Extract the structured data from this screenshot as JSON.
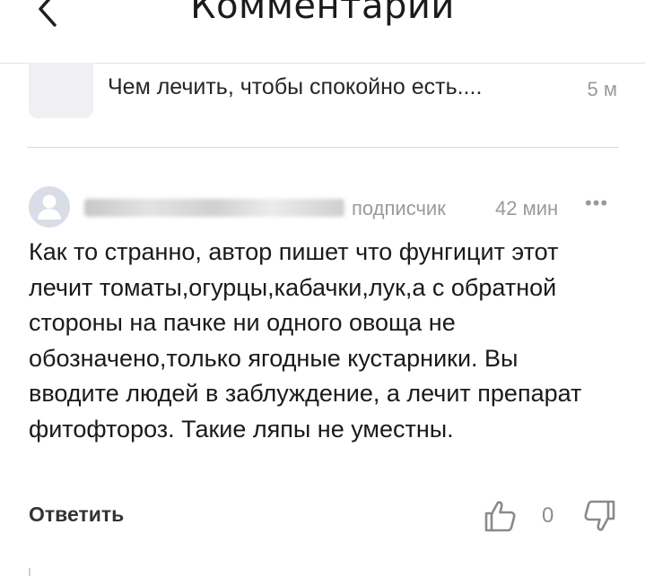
{
  "header": {
    "title": "Комментарии",
    "back_icon": "chevron-left-icon"
  },
  "article": {
    "title": "Чем лечить, чтобы спокойно есть....",
    "time": "5 м"
  },
  "comment": {
    "author_name": "",
    "author_badge": "подписчик",
    "time": "42 мин",
    "more_label": "•••",
    "text": "Как то странно, автор пишет что фунгицит этот лечит томаты,огурцы,кабачки,лук,а с обратной стороны на пачке ни одного овоща не обозначено,только ягодные кустарники. Вы вводите людей в заблуждение, а лечит препарат фитофтороз. Такие ляпы не уместны.",
    "reply_label": "Ответить",
    "like_count": "0",
    "like_icon": "thumbs-up-icon",
    "dislike_icon": "thumbs-down-icon"
  },
  "colors": {
    "text": "#1a1a1a",
    "secondary": "#9a9a9a",
    "divider": "#dcdcdc",
    "avatar_bg": "#d9dde8"
  }
}
